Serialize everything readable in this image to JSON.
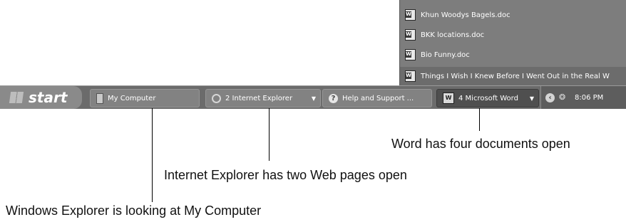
{
  "word_popup": {
    "items": [
      {
        "label": "Khun Woodys Bagels.doc"
      },
      {
        "label": "BKK locations.doc"
      },
      {
        "label": "Bio Funny.doc"
      },
      {
        "label": "Things I Wish I Knew Before I Went Out in the Real W"
      }
    ]
  },
  "taskbar": {
    "start_label": "start",
    "tasks": [
      {
        "label": "My Computer",
        "icon": "my-computer-icon"
      },
      {
        "label": "2 Internet Explorer",
        "icon": "internet-explorer-icon"
      },
      {
        "label": "Help and Support ...",
        "icon": "help-icon"
      },
      {
        "label": "4 Microsoft Word",
        "icon": "word-icon"
      }
    ],
    "tray": {
      "time": "8:06 PM"
    }
  },
  "callouts": {
    "word": "Word has four documents open",
    "ie": "Internet Explorer has two Web pages open",
    "explorer": "Windows Explorer is looking at My Computer"
  },
  "colors": {
    "taskbar": "#6b6b6b",
    "popup": "#7d7d7d",
    "active_task": "#4f4f4f"
  }
}
